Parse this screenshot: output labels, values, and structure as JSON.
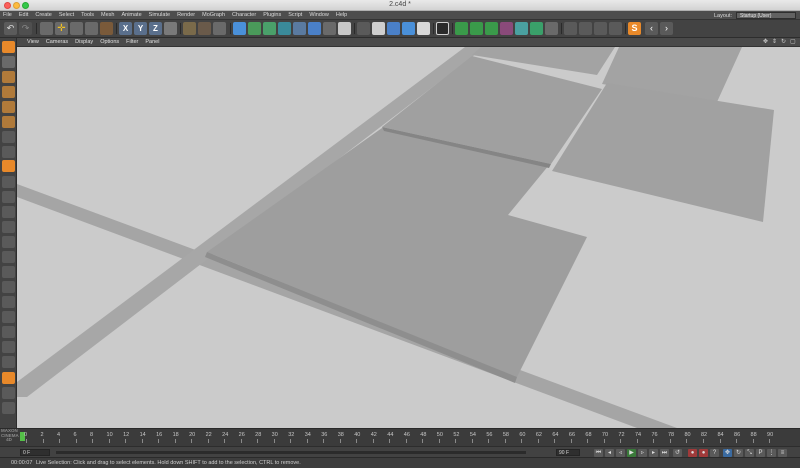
{
  "window": {
    "title": "2.c4d *"
  },
  "menu": {
    "items": [
      "File",
      "Edit",
      "Create",
      "Select",
      "Tools",
      "Mesh",
      "Animate",
      "Simulate",
      "Render",
      "MoGraph",
      "Character",
      "Plugins",
      "Script",
      "Window",
      "Help"
    ],
    "layout_label": "Layout:",
    "layout_value": "Startup (User)"
  },
  "viewport": {
    "menu_items": [
      "View",
      "Cameras",
      "Display",
      "Options",
      "Filter",
      "Panel"
    ]
  },
  "timeline": {
    "ticks": [
      "0",
      "2",
      "4",
      "6",
      "8",
      "10",
      "12",
      "14",
      "16",
      "18",
      "20",
      "22",
      "24",
      "26",
      "28",
      "30",
      "32",
      "34",
      "36",
      "38",
      "40",
      "42",
      "44",
      "46",
      "48",
      "50",
      "52",
      "54",
      "56",
      "58",
      "60",
      "62",
      "64",
      "66",
      "68",
      "70",
      "72",
      "74",
      "76",
      "78",
      "80",
      "82",
      "84",
      "86",
      "88",
      "90"
    ],
    "logo_text": "MAXON CINEMA 4D"
  },
  "transport": {
    "current_frame": "0 F",
    "end_frame": "90 F"
  },
  "status": {
    "time": "00:00:07",
    "message": "Live Selection: Click and drag to select elements. Hold down SHIFT to add to the selection, CTRL to remove."
  },
  "colors": {
    "viewport_bg": "#cbcbcb",
    "plane": "#9d9d9d",
    "road": "#a3a3a3",
    "playhead": "#54c048",
    "accent_orange": "#e8892a",
    "accent_blue": "#4a90d9"
  }
}
